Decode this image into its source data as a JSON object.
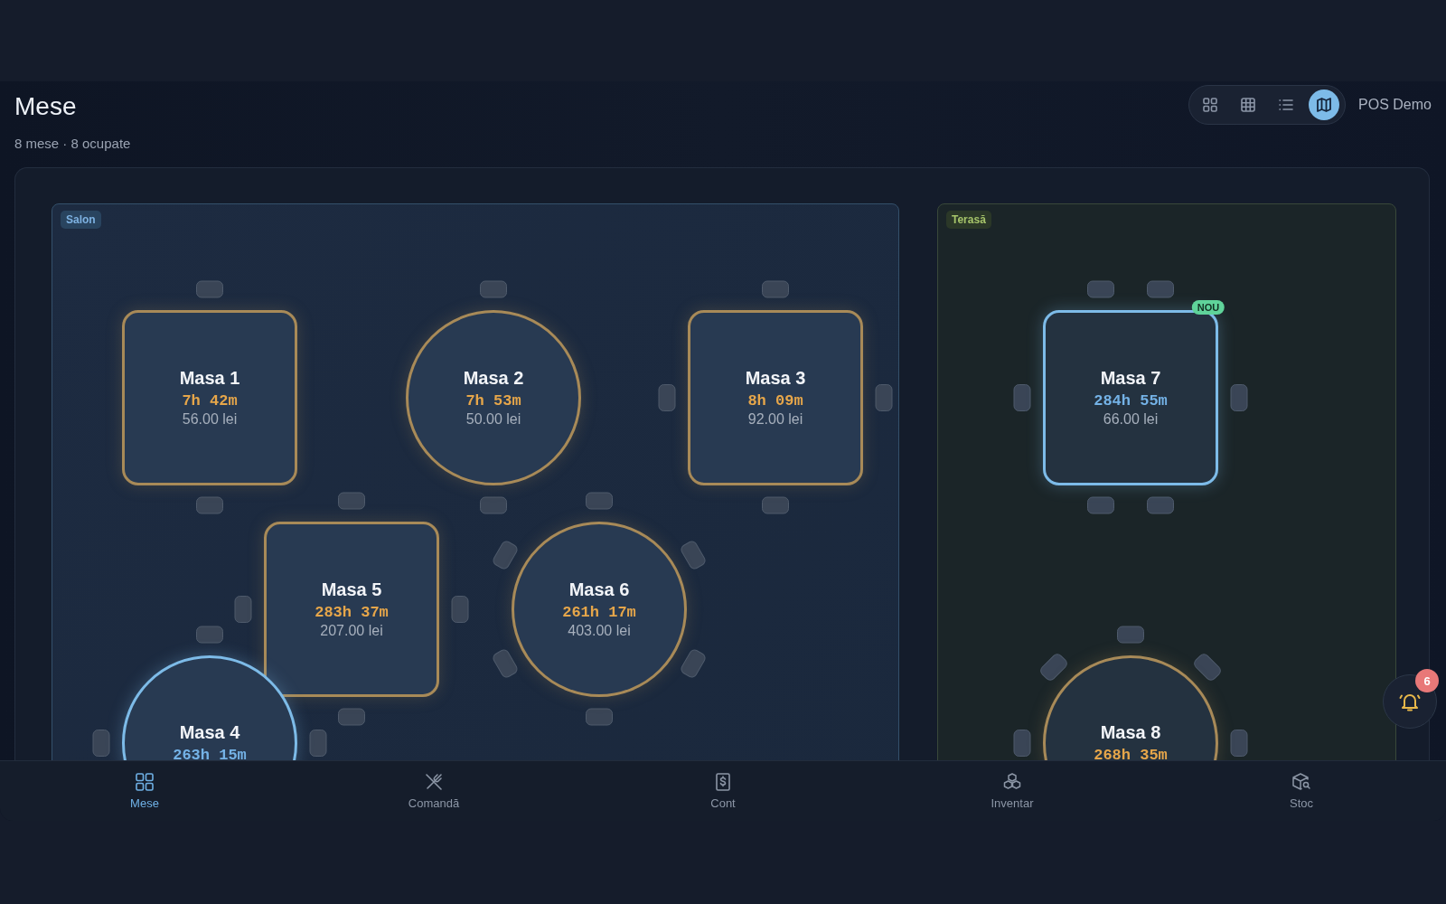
{
  "header": {
    "title": "Mese",
    "subtitle": "8 mese · 8 ocupate",
    "user": "POS Demo"
  },
  "view_modes": [
    {
      "kind": "cards",
      "selected": false
    },
    {
      "kind": "grid",
      "selected": false
    },
    {
      "kind": "list",
      "selected": false
    },
    {
      "kind": "map",
      "selected": true
    }
  ],
  "zones": [
    {
      "label": "Salon",
      "kind": "indoor",
      "tables": [
        {
          "name": "Masa 1",
          "kind": "square",
          "new": false,
          "timer": "7h 42m",
          "total": "56.00 lei"
        },
        {
          "name": "Masa 2",
          "kind": "round",
          "new": false,
          "timer": "7h 53m",
          "total": "50.00 lei"
        },
        {
          "name": "Masa 3",
          "kind": "square",
          "new": false,
          "timer": "8h 09m",
          "total": "92.00 lei"
        },
        {
          "name": "Masa 5",
          "kind": "square",
          "new": false,
          "timer": "283h 37m",
          "total": "207.00 lei"
        },
        {
          "name": "Masa 6",
          "kind": "round",
          "new": false,
          "timer": "261h 17m",
          "total": "403.00 lei"
        },
        {
          "name": "Masa 4",
          "kind": "round",
          "new": true,
          "timer": "263h 15m"
        }
      ]
    },
    {
      "label": "Terasă",
      "kind": "outdoor",
      "tables": [
        {
          "name": "Masa 7",
          "kind": "square",
          "new": true,
          "timer": "284h 55m",
          "total": "66.00 lei",
          "badge": "NOU"
        },
        {
          "name": "Masa 8",
          "kind": "round",
          "new": false,
          "timer": "268h 35m"
        }
      ]
    }
  ],
  "notifications": {
    "count": "6"
  },
  "nav": [
    {
      "label": "Mese",
      "kind": "tables",
      "selected": true
    },
    {
      "label": "Comandă",
      "kind": "order",
      "selected": false
    },
    {
      "label": "Cont",
      "kind": "bill",
      "selected": false
    },
    {
      "label": "Inventar",
      "kind": "inventory",
      "selected": false
    },
    {
      "label": "Stoc",
      "kind": "stock",
      "selected": false
    }
  ]
}
